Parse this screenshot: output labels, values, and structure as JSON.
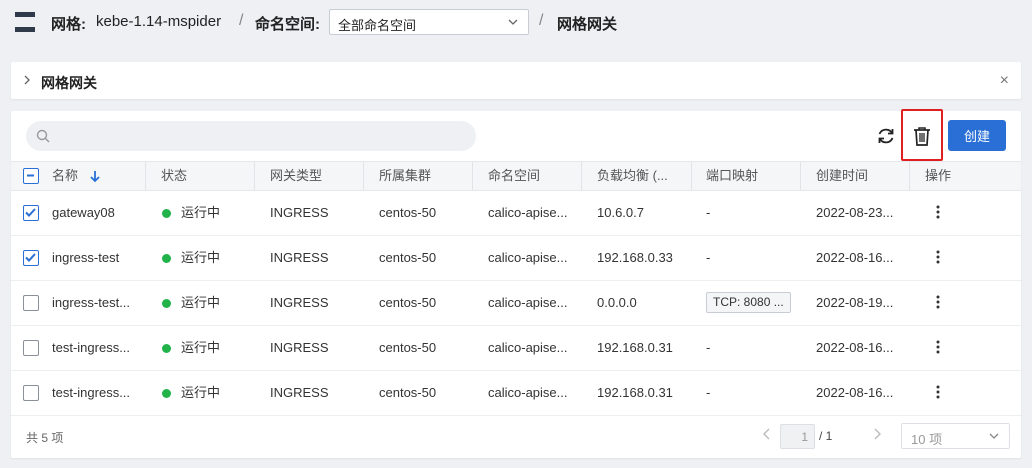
{
  "header": {
    "mesh_label": "网格:",
    "mesh_value": "kebe-1.14-mspider",
    "separator": "/",
    "namespace_label": "命名空间:",
    "namespace_selected": "全部命名空间",
    "page_title": "网格网关"
  },
  "info_panel": {
    "title": "网格网关",
    "close": "×"
  },
  "toolbar": {
    "search_placeholder": "",
    "create_label": "创建"
  },
  "table": {
    "columns": [
      "名称",
      "状态",
      "网关类型",
      "所属集群",
      "命名空间",
      "负载均衡 (...",
      "端口映射",
      "创建时间",
      "操作"
    ],
    "rows": [
      {
        "checked": true,
        "name": "gateway08",
        "status": "运行中",
        "type": "INGRESS",
        "cluster": "centos-50",
        "namespace": "calico-apise...",
        "lb": "10.6.0.7",
        "ports": "-",
        "created": "2022-08-23..."
      },
      {
        "checked": true,
        "name": "ingress-test",
        "status": "运行中",
        "type": "INGRESS",
        "cluster": "centos-50",
        "namespace": "calico-apise...",
        "lb": "192.168.0.33",
        "ports": "-",
        "created": "2022-08-16..."
      },
      {
        "checked": false,
        "name": "ingress-test...",
        "status": "运行中",
        "type": "INGRESS",
        "cluster": "centos-50",
        "namespace": "calico-apise...",
        "lb": "0.0.0.0",
        "ports": "TCP: 8080 ...",
        "created": "2022-08-19..."
      },
      {
        "checked": false,
        "name": "test-ingress...",
        "status": "运行中",
        "type": "INGRESS",
        "cluster": "centos-50",
        "namespace": "calico-apise...",
        "lb": "192.168.0.31",
        "ports": "-",
        "created": "2022-08-16..."
      },
      {
        "checked": false,
        "name": "test-ingress...",
        "status": "运行中",
        "type": "INGRESS",
        "cluster": "centos-50",
        "namespace": "calico-apise...",
        "lb": "192.168.0.31",
        "ports": "-",
        "created": "2022-08-16..."
      }
    ]
  },
  "footer": {
    "total": "共 5 项",
    "current_page": "1",
    "page_total": "/ 1",
    "page_size": "10 项"
  },
  "colors": {
    "primary": "#2a6fd6",
    "running": "#21b24a",
    "highlight_box": "#e02020"
  }
}
